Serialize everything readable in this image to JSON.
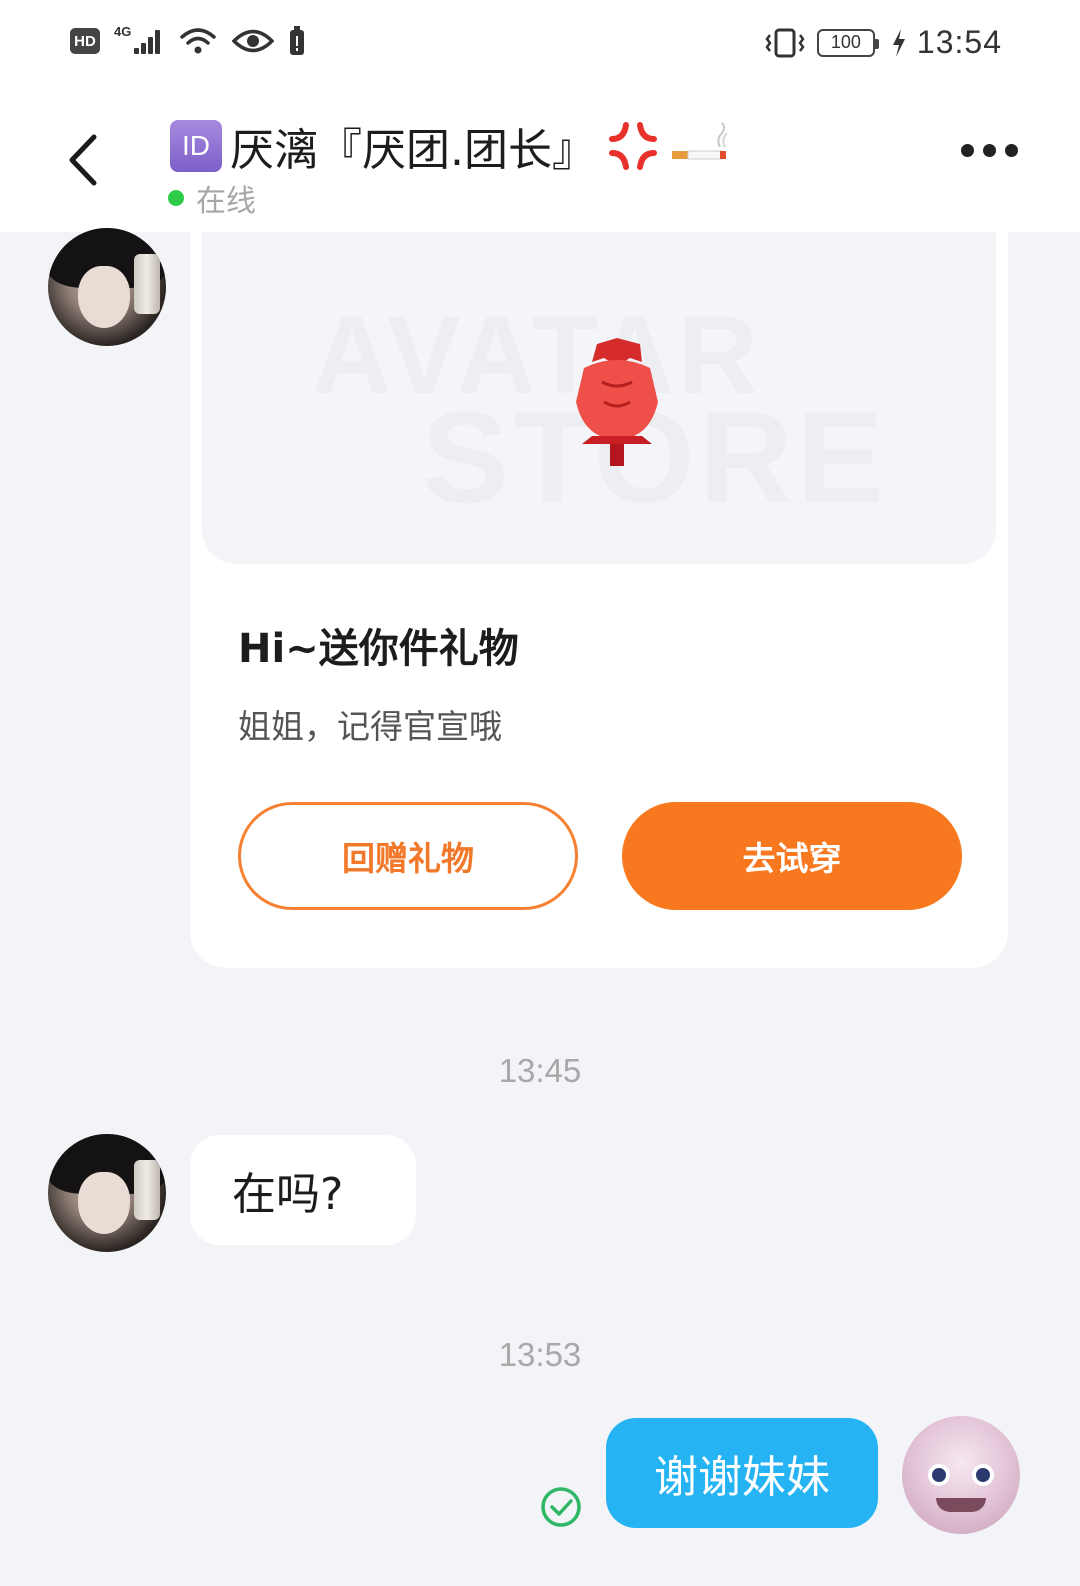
{
  "status_bar": {
    "hd_label": "HD",
    "network_label": "4G",
    "battery_level": "100",
    "time": "13:54"
  },
  "header": {
    "id_badge": "ID",
    "title": "厌漓『厌团.团长』",
    "status": "在线",
    "emojis": [
      "anger-symbol-icon",
      "cigarette-icon"
    ]
  },
  "gift_card": {
    "watermark_line1": "AVATAR",
    "watermark_line2": "STORE",
    "title": "Hi~送你件礼物",
    "subtitle": "姐姐，记得官宣哦",
    "return_gift_label": "回赠礼物",
    "try_on_label": "去试穿"
  },
  "messages": [
    {
      "timestamp": "13:45",
      "text": "在吗?",
      "direction": "incoming"
    },
    {
      "timestamp": "13:53",
      "text": "谢谢妹妹",
      "direction": "outgoing",
      "read": true
    }
  ],
  "colors": {
    "accent_orange": "#f7781f",
    "outgoing_bubble": "#26b3f4",
    "online_green": "#2ecb4a",
    "id_badge_purple": "#8c6fd3"
  }
}
